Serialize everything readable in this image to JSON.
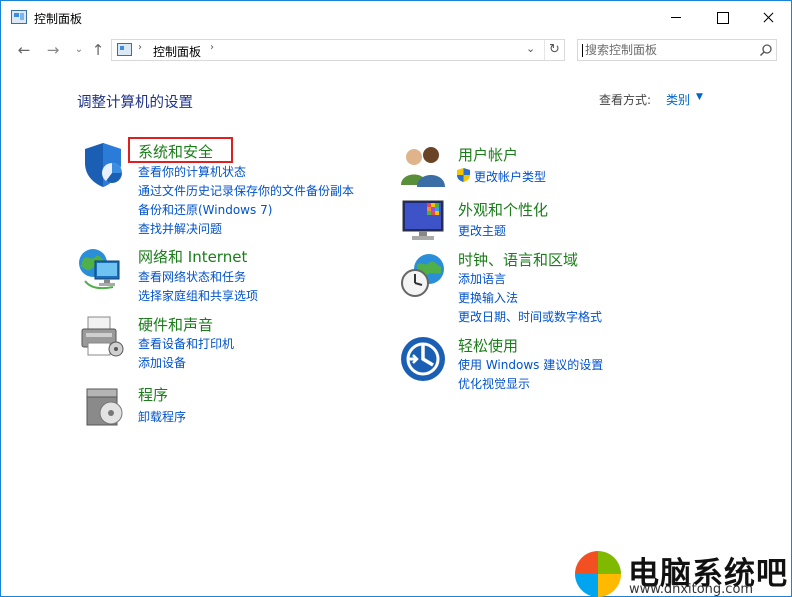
{
  "window": {
    "title": "控制面板"
  },
  "nav": {
    "back": "←",
    "forward": "→",
    "recent": "⌄",
    "up": "↑"
  },
  "address": {
    "sep1": "›",
    "crumb": "控制面板",
    "sep2": "›",
    "dropdown": "⌄",
    "refresh": "↻"
  },
  "search": {
    "placeholder": "搜索控制面板"
  },
  "header": {
    "title": "调整计算机的设置",
    "viewby_label": "查看方式:",
    "viewby_value": "类别",
    "viewby_arrow": "▼"
  },
  "categories": {
    "system": {
      "title": "系统和安全",
      "links": [
        "查看你的计算机状态",
        "通过文件历史记录保存你的文件备份副本",
        "备份和还原(Windows 7)",
        "查找并解决问题"
      ]
    },
    "network": {
      "title": "网络和 Internet",
      "links": [
        "查看网络状态和任务",
        "选择家庭组和共享选项"
      ]
    },
    "hardware": {
      "title": "硬件和声音",
      "links": [
        "查看设备和打印机",
        "添加设备"
      ]
    },
    "programs": {
      "title": "程序",
      "links": [
        "卸载程序"
      ]
    },
    "users": {
      "title": "用户帐户",
      "links": [
        "更改帐户类型"
      ]
    },
    "appearance": {
      "title": "外观和个性化",
      "links": [
        "更改主题"
      ]
    },
    "clock": {
      "title": "时钟、语言和区域",
      "links": [
        "添加语言",
        "更换输入法",
        "更改日期、时间或数字格式"
      ]
    },
    "ease": {
      "title": "轻松使用",
      "links": [
        "使用 Windows 建议的设置",
        "优化视觉显示"
      ]
    }
  },
  "watermark": {
    "title": "电脑系统吧",
    "url": "www.dnxitong.com"
  },
  "colors": {
    "accent": "#1883d7",
    "category_title": "#1a7d1a",
    "link": "#0052cc",
    "heading": "#1e3287",
    "highlight": "#e02020"
  }
}
